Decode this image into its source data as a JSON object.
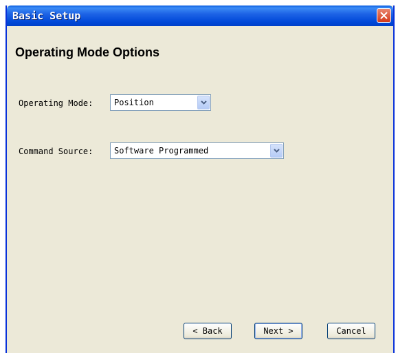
{
  "window": {
    "title": "Basic Setup"
  },
  "page": {
    "title": "Operating Mode Options"
  },
  "form": {
    "operating_mode_label": "Operating Mode:",
    "operating_mode_value": "Position",
    "command_source_label": "Command Source:",
    "command_source_value": "Software Programmed"
  },
  "buttons": {
    "back": "< Back",
    "next": "Next >",
    "cancel": "Cancel"
  },
  "colors": {
    "titlebar": "#0048d8",
    "window_bg": "#ece9d8",
    "close_button": "#d4391a"
  }
}
